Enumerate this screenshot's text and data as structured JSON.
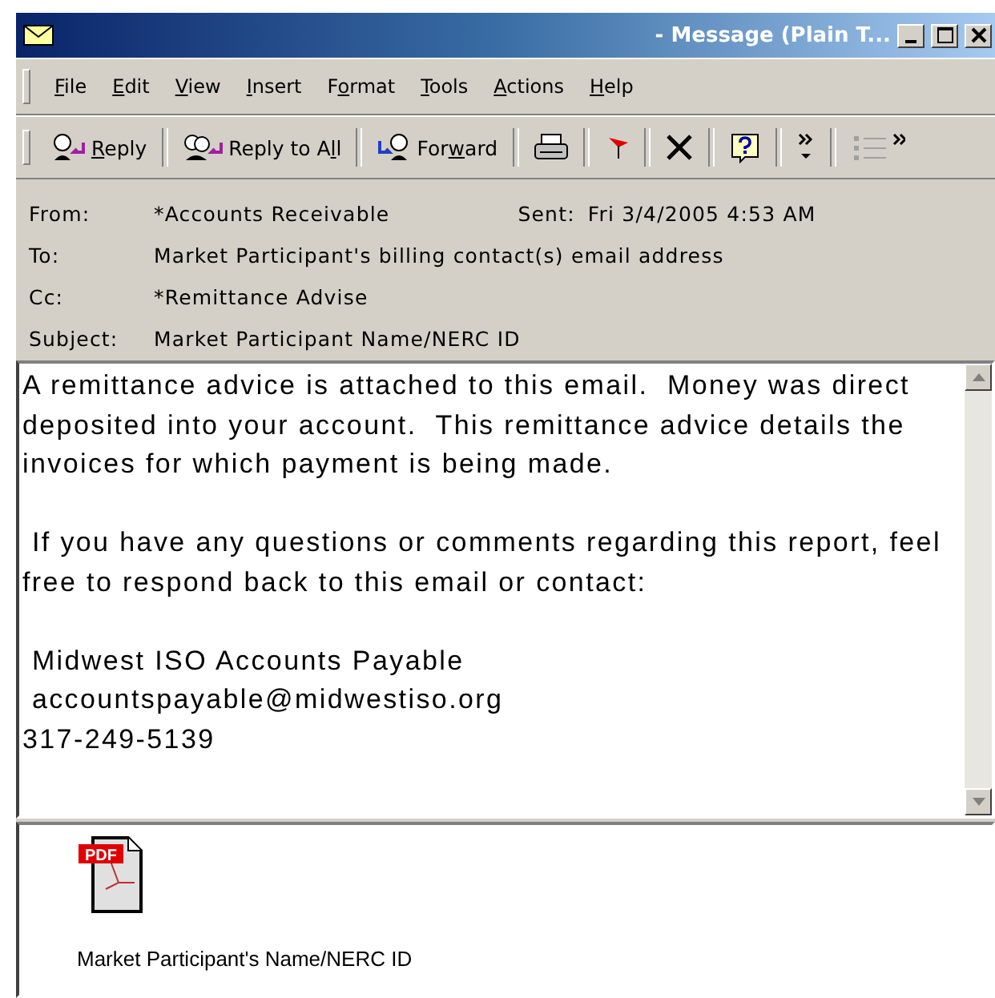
{
  "window": {
    "title": "- Message (Plain T..."
  },
  "menu": [
    {
      "mnemonic": "F",
      "rest": "ile"
    },
    {
      "mnemonic": "E",
      "rest": "dit"
    },
    {
      "mnemonic": "V",
      "rest": "iew"
    },
    {
      "mnemonic": "I",
      "rest": "nsert"
    },
    {
      "lead": "F",
      "mnemonic": "o",
      "rest": "rmat"
    },
    {
      "mnemonic": "T",
      "rest": "ools"
    },
    {
      "mnemonic": "A",
      "rest": "ctions"
    },
    {
      "mnemonic": "H",
      "rest": "elp"
    }
  ],
  "toolbar": [
    {
      "kind": "reply",
      "mnemonic": "R",
      "rest": "eply"
    },
    {
      "kind": "reply-all",
      "lead": "Reply to A",
      "mnemonic": "l",
      "rest": "l"
    },
    {
      "kind": "forward",
      "lead": "For",
      "mnemonic": "w",
      "rest": "ard"
    },
    {
      "kind": "print"
    },
    {
      "kind": "flag"
    },
    {
      "kind": "delete"
    },
    {
      "kind": "help"
    },
    {
      "kind": "more"
    },
    {
      "kind": "bullets"
    }
  ],
  "header": {
    "from_label": "From:",
    "from": "*Accounts Receivable",
    "sent_label": "Sent:",
    "sent": "Fri 3/4/2005 4:53 AM",
    "to_label": "To:",
    "to": "Market Participant's billing contact(s) email address",
    "cc_label": "Cc:",
    "cc": "*Remittance Advise",
    "subject_label": "Subject:",
    "subject": "Market Participant Name/NERC ID"
  },
  "body": [
    "A remittance advice is attached to this email.  Money was direct\ndeposited into your account.  This remittance advice details the\ninvoices for which payment is being made.",
    " If you have any questions or comments regarding this report, feel\nfree to respond back to this email or contact:",
    " Midwest ISO Accounts Payable\n accountspayable@midwestiso.org\n317-249-5139"
  ],
  "attachments": [
    {
      "badge": "PDF",
      "name": "Market Participant's Name/NERC ID"
    }
  ]
}
